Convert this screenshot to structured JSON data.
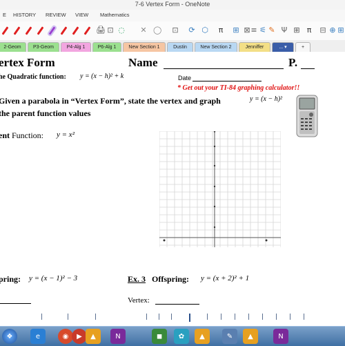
{
  "window": {
    "title": "7-6 Vertex Form - OneNote"
  },
  "ribbon": {
    "tabs": [
      "E",
      "HISTORY",
      "REVIEW",
      "VIEW",
      "Mathematics"
    ]
  },
  "toolbar": {
    "pen_colors": [
      "#e02020",
      "#e02020",
      "#e02020",
      "#e02020",
      "#9a3fd0",
      "#e02020",
      "#e02020",
      "#e02020"
    ],
    "symbols": [
      "🖨",
      "⊡",
      "◌",
      "✕",
      "◯",
      "⊡",
      "⟳",
      "⬡",
      "π",
      "⊞",
      "⊠",
      "≡",
      "⚟",
      "✎",
      "Ψ",
      "⊞",
      "π",
      "⊟",
      "⊕",
      "⊞"
    ]
  },
  "sections": [
    {
      "label": "2-Geom",
      "color": "#9be08f"
    },
    {
      "label": "P3-Geom",
      "color": "#9be08f"
    },
    {
      "label": "P4-Alg 1",
      "color": "#f2a6e0"
    },
    {
      "label": "P6-Alg 1",
      "color": "#9be08f"
    },
    {
      "label": "New Section 1",
      "color": "#f6c6a3"
    },
    {
      "label": "Dustin",
      "color": "#b9d8f3"
    },
    {
      "label": "New Section 2",
      "color": "#b9d8f3"
    },
    {
      "label": "Jenniffer",
      "color": "#f3df86"
    },
    {
      "label": "... ▾",
      "color": "#3a5da8"
    },
    {
      "label": "+",
      "color": "#f7f7f7"
    }
  ],
  "page": {
    "title": "ertex Form",
    "name_label": "Name",
    "period_label": "P.",
    "quad_label": "he Quadratic function:",
    "quad_formula": "y = (x − h)² + k",
    "date_label": "Date",
    "calculator_note": "* Get out your TI-84 graphing calculator!!",
    "instruction_line1": "Given a parabola in “Vertex Form”, state the vertex and graph",
    "instruction_formula": "y = (x − h)²",
    "instruction_line2": "the parent function values",
    "parent_prefix": "ent",
    "parent_label": " Function:",
    "parent_formula": "y = x²",
    "ex2_label": "pring:",
    "ex2_formula": "y = (x − 1)² − 3",
    "ex3_num": "Ex. 3",
    "ex3_label": "Offspring:",
    "ex3_formula": "y = (x + 2)² + 1",
    "vertex_label": "Vertex:"
  },
  "taskbar": {
    "apps": [
      {
        "name": "ie-icon",
        "glyph": "e",
        "color": "#2a7fd4"
      },
      {
        "name": "chrome-icon",
        "glyph": "◉",
        "color": "#d84a2a"
      },
      {
        "name": "media-icon",
        "glyph": "▶",
        "color": "#c83a2a"
      },
      {
        "name": "cart-icon",
        "glyph": "▲",
        "color": "#e7a020"
      },
      {
        "name": "onenote-icon",
        "glyph": "N",
        "color": "#7a2a9a"
      },
      {
        "name": "camtasia-icon",
        "glyph": "◼",
        "color": "#3a8a3a"
      },
      {
        "name": "photos-icon",
        "glyph": "✿",
        "color": "#2aa0c0"
      },
      {
        "name": "cart-icon-2",
        "glyph": "▲",
        "color": "#e7a020"
      },
      {
        "name": "pen-tool-icon",
        "glyph": "✎",
        "color": "#5a7fb0"
      },
      {
        "name": "calc-icon",
        "glyph": "▲",
        "color": "#e7a020"
      },
      {
        "name": "onenote-icon-2",
        "glyph": "N",
        "color": "#7a2a9a"
      }
    ]
  }
}
